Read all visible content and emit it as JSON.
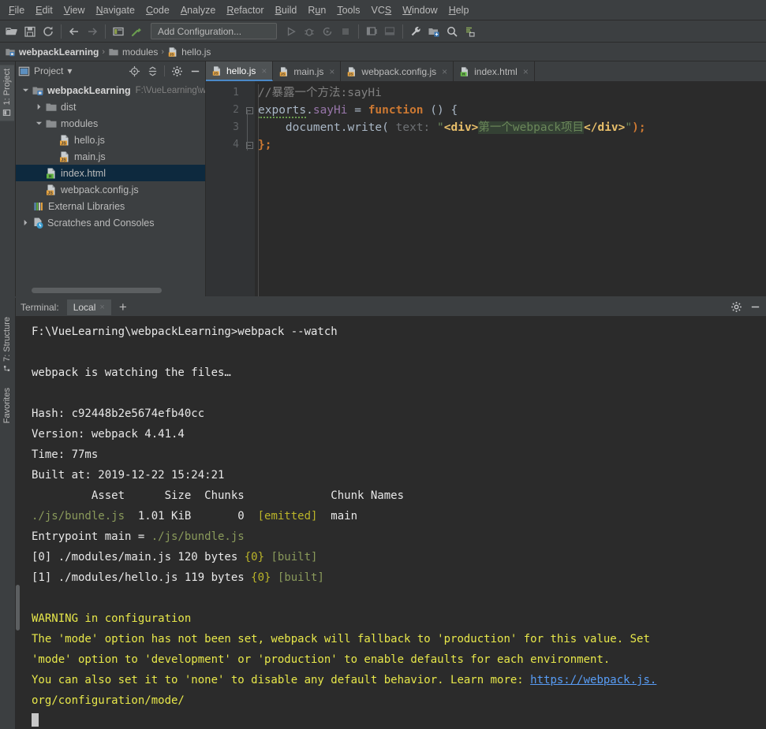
{
  "menubar": {
    "items": [
      {
        "label": "File"
      },
      {
        "label": "Edit"
      },
      {
        "label": "View"
      },
      {
        "label": "Navigate"
      },
      {
        "label": "Code"
      },
      {
        "label": "Analyze"
      },
      {
        "label": "Refactor"
      },
      {
        "label": "Build"
      },
      {
        "label": "Run"
      },
      {
        "label": "Tools"
      },
      {
        "label": "VCS"
      },
      {
        "label": "Window"
      },
      {
        "label": "Help"
      }
    ]
  },
  "toolbar": {
    "add_configuration": "Add Configuration...",
    "icons": [
      "open-folder-icon",
      "save-all-icon",
      "sync-refresh-icon",
      "back-arrow-icon",
      "forward-arrow-icon",
      "project-structure-icon",
      "build-hammer-icon",
      "run-icon",
      "debug-icon",
      "run-coverage-icon",
      "stop-icon",
      "layout-left-icon",
      "layout-bottom-icon",
      "settings-wrench-icon",
      "project-settings-icon",
      "search-icon",
      "update-project-icon"
    ]
  },
  "breadcrumb": {
    "items": [
      {
        "label": "webpackLearning",
        "icon": "module-icon",
        "bold": true
      },
      {
        "label": "modules",
        "icon": "folder-icon",
        "bold": false
      },
      {
        "label": "hello.js",
        "icon": "js-file-icon",
        "bold": false
      }
    ],
    "separator": "›"
  },
  "left_strip": {
    "project_tab": "1: Project"
  },
  "bottom_strip": {
    "structure_tab": "7: Structure",
    "favorites_tab": "Favorites"
  },
  "project_panel": {
    "title": "Project",
    "dropdown_caret": "▾",
    "buttons": [
      "locate-target-icon",
      "collapse-all-icon",
      "settings-gear-icon",
      "hide-panel-icon"
    ],
    "tree": [
      {
        "label": "webpackLearning",
        "path": "F:\\VueLearning\\w",
        "icon": "module-icon",
        "indent": 0,
        "twist": "open",
        "bold": true,
        "selected": false
      },
      {
        "label": "dist",
        "path": "",
        "icon": "folder-icon",
        "indent": 1,
        "twist": "closed",
        "bold": false,
        "selected": false
      },
      {
        "label": "modules",
        "path": "",
        "icon": "folder-icon",
        "indent": 1,
        "twist": "open",
        "bold": false,
        "selected": false
      },
      {
        "label": "hello.js",
        "path": "",
        "icon": "js-file-icon",
        "indent": 2,
        "twist": "none",
        "bold": false,
        "selected": false
      },
      {
        "label": "main.js",
        "path": "",
        "icon": "js-file-icon",
        "indent": 2,
        "twist": "none",
        "bold": false,
        "selected": false
      },
      {
        "label": "index.html",
        "path": "",
        "icon": "html-file-icon",
        "indent": 1,
        "twist": "none",
        "bold": false,
        "selected": true
      },
      {
        "label": "webpack.config.js",
        "path": "",
        "icon": "js-file-icon",
        "indent": 1,
        "twist": "none",
        "bold": false,
        "selected": false
      },
      {
        "label": "External Libraries",
        "path": "",
        "icon": "libraries-icon",
        "indent": 0,
        "twist": "none",
        "bold": false,
        "selected": false
      },
      {
        "label": "Scratches and Consoles",
        "path": "",
        "icon": "scratches-icon",
        "indent": 0,
        "twist": "closed",
        "bold": false,
        "selected": false
      }
    ]
  },
  "editor": {
    "tabs": [
      {
        "label": "hello.js",
        "icon": "js-file-icon",
        "active": true,
        "close": "×"
      },
      {
        "label": "main.js",
        "icon": "js-file-icon",
        "active": false,
        "close": "×"
      },
      {
        "label": "webpack.config.js",
        "icon": "js-file-icon",
        "active": false,
        "close": "×"
      },
      {
        "label": "index.html",
        "icon": "html-file-icon",
        "active": false,
        "close": "×"
      }
    ],
    "line_numbers": [
      "1",
      "2",
      "3",
      "4"
    ],
    "code": {
      "line1_comment": "//暴露一个方法:sayHi",
      "line2_exports": "exports",
      "line2_dot": ".",
      "line2_sayhi": "sayHi",
      "line2_assign": " = ",
      "line2_function": "function",
      "line2_parens": " () {",
      "line3_indent": "    ",
      "line3_document": "document",
      "line3_dot": ".",
      "line3_write": "write",
      "line3_open": "( ",
      "line3_hint": "text: ",
      "line3_quote_open": "\"",
      "line3_tag_open": "<div>",
      "line3_text": "第一个webpack项目",
      "line3_tag_close": "</div>",
      "line3_quote_close": "\"",
      "line3_end": ");",
      "line4": "};"
    },
    "fold_marker": "−"
  },
  "terminal": {
    "title": "Terminal:",
    "tab_label": "Local",
    "tab_close": "×",
    "new_tab": "+",
    "header_buttons": [
      "settings-gear-icon",
      "hide-panel-icon"
    ],
    "lines": [
      {
        "segments": [
          {
            "t": "F:\\VueLearning\\webpackLearning>webpack --watch",
            "c": "t-white"
          }
        ]
      },
      {
        "segments": [
          {
            "t": "",
            "c": "t-white"
          }
        ]
      },
      {
        "segments": [
          {
            "t": "webpack is watching the files…",
            "c": "t-white"
          }
        ]
      },
      {
        "segments": [
          {
            "t": "",
            "c": "t-white"
          }
        ]
      },
      {
        "segments": [
          {
            "t": "Hash: c92448b2e5674efb40cc",
            "c": "t-white"
          }
        ]
      },
      {
        "segments": [
          {
            "t": "Version: webpack 4.41.4",
            "c": "t-white"
          }
        ]
      },
      {
        "segments": [
          {
            "t": "Time: 77ms",
            "c": "t-white"
          }
        ]
      },
      {
        "segments": [
          {
            "t": "Built at: 2019-12-22 15:24:21",
            "c": "t-white"
          }
        ]
      },
      {
        "segments": [
          {
            "t": "         Asset      Size  Chunks             Chunk Names",
            "c": "t-white"
          }
        ]
      },
      {
        "segments": [
          {
            "t": "./js/bundle.js",
            "c": "t-green"
          },
          {
            "t": "  1.01 KiB       0  ",
            "c": "t-white"
          },
          {
            "t": "[emitted]",
            "c": "t-yellowgreen"
          },
          {
            "t": "  main",
            "c": "t-white"
          }
        ]
      },
      {
        "segments": [
          {
            "t": "Entrypoint main = ",
            "c": "t-white"
          },
          {
            "t": "./js/bundle.js",
            "c": "t-green"
          }
        ]
      },
      {
        "segments": [
          {
            "t": "[0] ./modules/main.js 120 bytes ",
            "c": "t-white"
          },
          {
            "t": "{0}",
            "c": "t-yellowgreen"
          },
          {
            "t": " ",
            "c": "t-white"
          },
          {
            "t": "[built]",
            "c": "t-green"
          }
        ]
      },
      {
        "segments": [
          {
            "t": "[1] ./modules/hello.js 119 bytes ",
            "c": "t-white"
          },
          {
            "t": "{0}",
            "c": "t-yellowgreen"
          },
          {
            "t": " ",
            "c": "t-white"
          },
          {
            "t": "[built]",
            "c": "t-green"
          }
        ]
      },
      {
        "segments": [
          {
            "t": "",
            "c": "t-white"
          }
        ]
      },
      {
        "segments": [
          {
            "t": "WARNING in configuration",
            "c": "t-yellow"
          }
        ]
      },
      {
        "segments": [
          {
            "t": "The 'mode' option has not been set, webpack will fallback to 'production' for this value. Set",
            "c": "t-yellow"
          }
        ]
      },
      {
        "segments": [
          {
            "t": "'mode' option to 'development' or 'production' to enable defaults for each environment.",
            "c": "t-yellow"
          }
        ]
      },
      {
        "segments": [
          {
            "t": "You can also set it to 'none' to disable any default behavior. Learn more: ",
            "c": "t-yellow"
          },
          {
            "t": "https://webpack.js.",
            "c": "t-link"
          }
        ]
      },
      {
        "segments": [
          {
            "t": "org/configuration/mode/",
            "c": "t-yellow"
          }
        ]
      }
    ]
  },
  "colors": {
    "panel_bg": "#3c3f41",
    "editor_bg": "#2b2b2b",
    "selection_blue": "#0d293e",
    "tab_active": "#4e5254",
    "accent_underline": "#4a88c7",
    "link_blue": "#589df6",
    "warning_yellow": "#e8e84a"
  }
}
